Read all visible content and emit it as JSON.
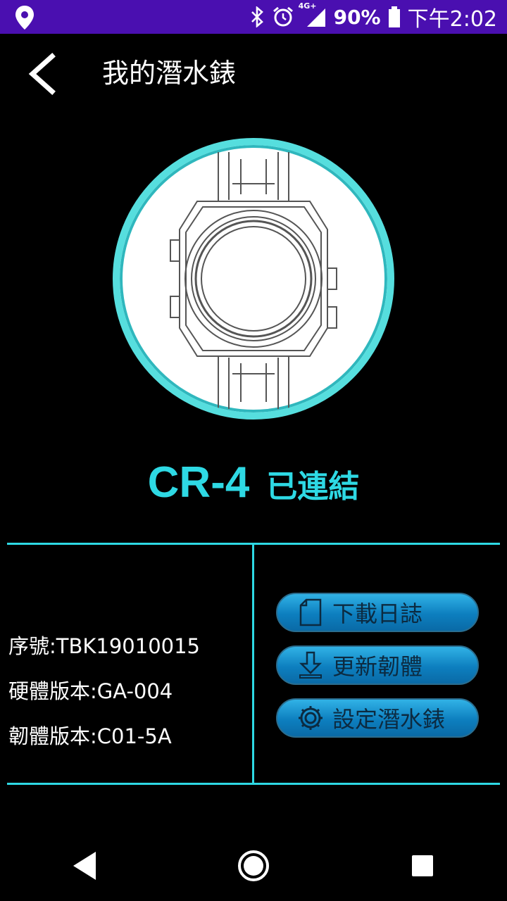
{
  "status_bar": {
    "network": "4G+",
    "battery": "90%",
    "time": "下午2:02",
    "icons": [
      "location-icon",
      "bluetooth-icon",
      "alarm-icon",
      "signal-icon",
      "battery-icon"
    ]
  },
  "header": {
    "title": "我的潛水錶"
  },
  "device": {
    "name": "CR-4",
    "status": "已連結"
  },
  "info": {
    "serial": "序號:TBK19010015",
    "hardware": "硬體版本:GA-004",
    "firmware": "韌體版本:C01-5A"
  },
  "actions": {
    "download_log": "下載日誌",
    "update_firmware": "更新韌體",
    "setup_watch": "設定潛水錶"
  },
  "colors": {
    "accent": "#2ed9e4",
    "status_bar": "#4a0fb0",
    "button": "#0d7fbf"
  }
}
